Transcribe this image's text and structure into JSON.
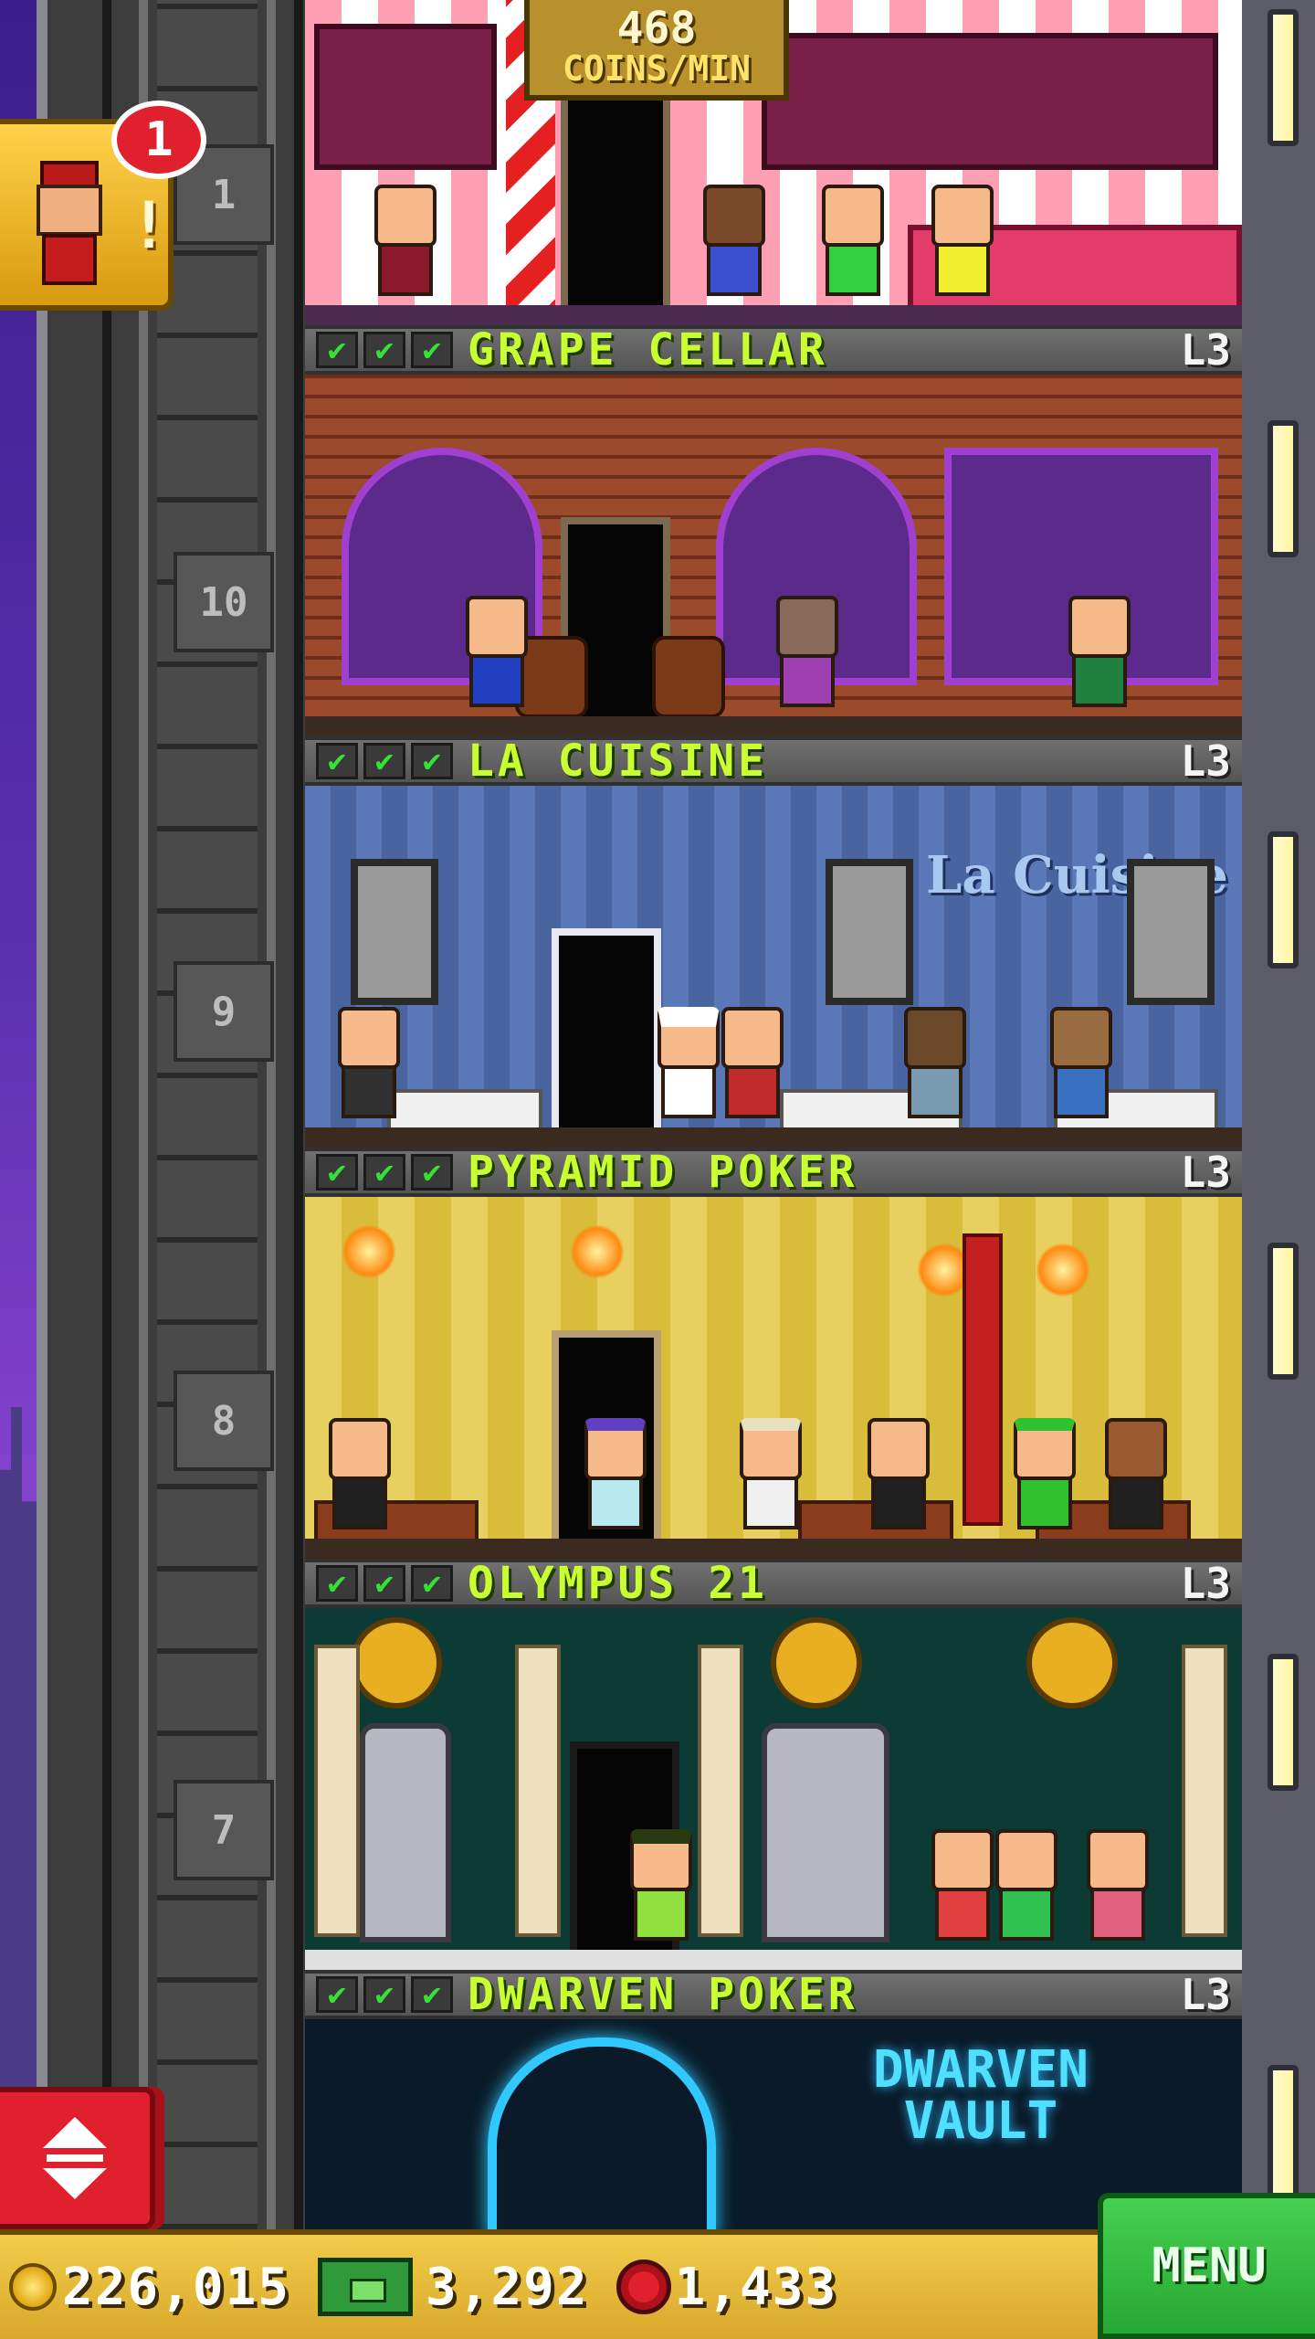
{
  "header": {
    "coins_per_min_value": "468",
    "coins_per_min_label": "COINS/MIN"
  },
  "bellhop": {
    "badge_count": "1",
    "alert": "!"
  },
  "shaft": {
    "floor_numbers": [
      "1",
      "10",
      "9",
      "8",
      "7"
    ]
  },
  "floors": [
    {
      "name": "GRAPE CELLAR",
      "level": "L3",
      "checks": [
        "✔",
        "✔",
        "✔"
      ]
    },
    {
      "name": "LA CUISINE",
      "level": "L3",
      "checks": [
        "✔",
        "✔",
        "✔"
      ],
      "sign": "La Cuisine"
    },
    {
      "name": "PYRAMID POKER",
      "level": "L3",
      "checks": [
        "✔",
        "✔",
        "✔"
      ]
    },
    {
      "name": "OLYMPUS 21",
      "level": "L3",
      "checks": [
        "✔",
        "✔",
        "✔"
      ]
    },
    {
      "name": "DWARVEN POKER",
      "level": "L3",
      "checks": [
        "✔",
        "✔",
        "✔"
      ],
      "sign": "DWARVEN VAULT"
    }
  ],
  "statusbar": {
    "coins": "226,015",
    "bux": "3,292",
    "gems": "1,433",
    "menu_label": "MENU"
  },
  "icons": [
    "coin-icon",
    "bux-icon",
    "gem-icon",
    "bellhop-icon",
    "elevator-arrows-icon"
  ],
  "colors": {
    "floor_name": "#c9ff30",
    "check": "#35e135",
    "menu": "#26a834",
    "status_bar": "#d8a82a",
    "elevator_button": "#e0202c"
  }
}
